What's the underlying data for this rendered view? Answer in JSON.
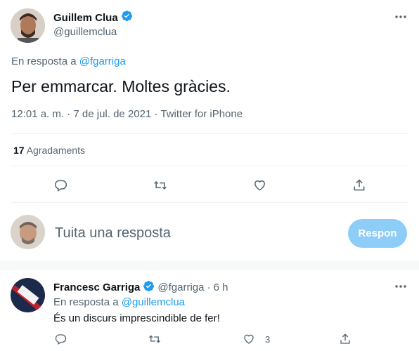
{
  "tweet": {
    "author_name": "Guillem Clua",
    "author_handle": "@guillemclua",
    "reply_prefix": "En resposta a",
    "reply_to": "@fgarriga",
    "text": "Per emmarcar. Moltes gràcies.",
    "meta": "12:01 a. m. · 7 de jul. de 2021 · Twitter for iPhone",
    "likes_count": "17",
    "likes_label": "Agradaments"
  },
  "composer": {
    "placeholder": "Tuita una resposta",
    "button_label": "Respon"
  },
  "reply": {
    "author_name": "Francesc Garriga",
    "author_handle": "@fgarriga",
    "time": "· 6 h",
    "reply_prefix": "En resposta a",
    "reply_to": "@guillemclua",
    "text": "És un discurs imprescindible de fer!",
    "like_count": "3"
  },
  "colors": {
    "accent": "#1d9bf0",
    "muted": "#536471",
    "button_disabled": "#8ecdf8"
  }
}
